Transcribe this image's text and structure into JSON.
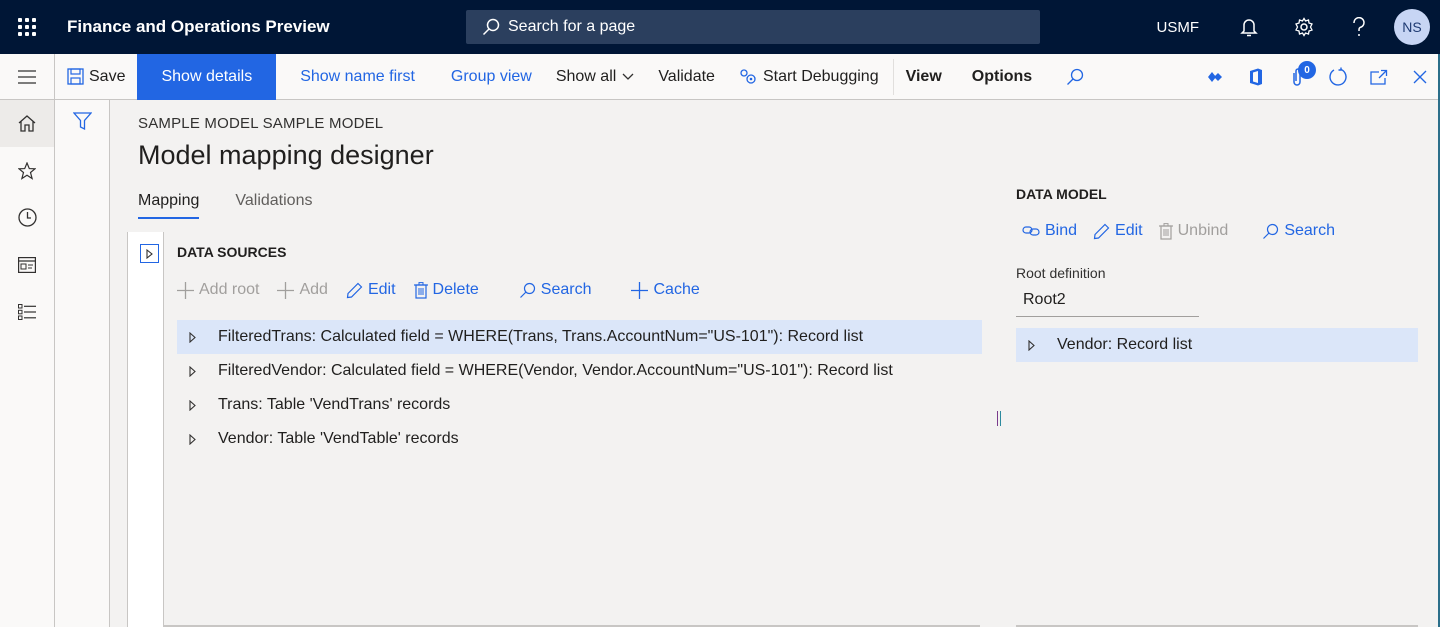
{
  "topbar": {
    "app_title": "Finance and Operations Preview",
    "search_placeholder": "Search for a page",
    "company": "USMF",
    "avatar_initials": "NS"
  },
  "actionpane": {
    "save": "Save",
    "show_details": "Show details",
    "show_name_first": "Show name first",
    "group_view": "Group view",
    "show_all": "Show all",
    "validate": "Validate",
    "start_debugging": "Start Debugging",
    "view": "View",
    "options": "Options",
    "attachments_count": "0"
  },
  "page": {
    "caption": "SAMPLE MODEL SAMPLE MODEL",
    "title": "Model mapping designer",
    "tabs": [
      {
        "label": "Mapping",
        "active": true
      },
      {
        "label": "Validations",
        "active": false
      }
    ]
  },
  "data_sources": {
    "header": "DATA SOURCES",
    "toolbar": {
      "add_root": "Add root",
      "add": "Add",
      "edit": "Edit",
      "delete": "Delete",
      "search": "Search",
      "cache": "Cache"
    },
    "items": [
      {
        "label": "FilteredTrans: Calculated field = WHERE(Trans, Trans.AccountNum=\"US-101\"): Record list",
        "selected": true
      },
      {
        "label": "FilteredVendor: Calculated field = WHERE(Vendor, Vendor.AccountNum=\"US-101\"): Record list",
        "selected": false
      },
      {
        "label": "Trans: Table 'VendTrans' records",
        "selected": false
      },
      {
        "label": "Vendor: Table 'VendTable' records",
        "selected": false
      }
    ]
  },
  "data_model": {
    "header": "DATA MODEL",
    "toolbar": {
      "bind": "Bind",
      "edit": "Edit",
      "unbind": "Unbind",
      "search": "Search"
    },
    "root_definition_label": "Root definition",
    "root_definition_value": "Root2",
    "items": [
      {
        "label": "Vendor: Record list",
        "selected": true
      }
    ]
  },
  "colors": {
    "topbar_bg": "#001636",
    "accent": "#2266e3",
    "selected_row": "#dbe6f9",
    "disabled": "#a19f9d"
  }
}
